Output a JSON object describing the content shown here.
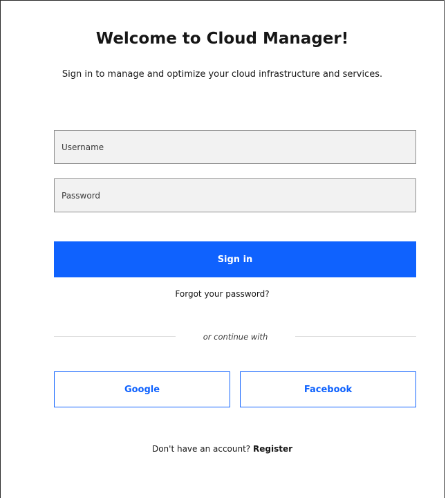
{
  "header": {
    "title": "Welcome to Cloud Manager!",
    "subtitle": "Sign in to manage and optimize your cloud infrastructure and services."
  },
  "form": {
    "username": {
      "placeholder": "Username",
      "value": ""
    },
    "password": {
      "placeholder": "Password",
      "value": ""
    },
    "signin_label": "Sign in",
    "forgot_label": "Forgot your password?"
  },
  "social": {
    "divider_text": "or continue with",
    "google_label": "Google",
    "facebook_label": "Facebook"
  },
  "footer": {
    "prompt": "Don't have an account?",
    "register_label": "Register"
  },
  "colors": {
    "primary": "#0f62fe",
    "field_background": "#f2f2f2",
    "field_border": "#8d8d8d",
    "text": "#161616"
  }
}
